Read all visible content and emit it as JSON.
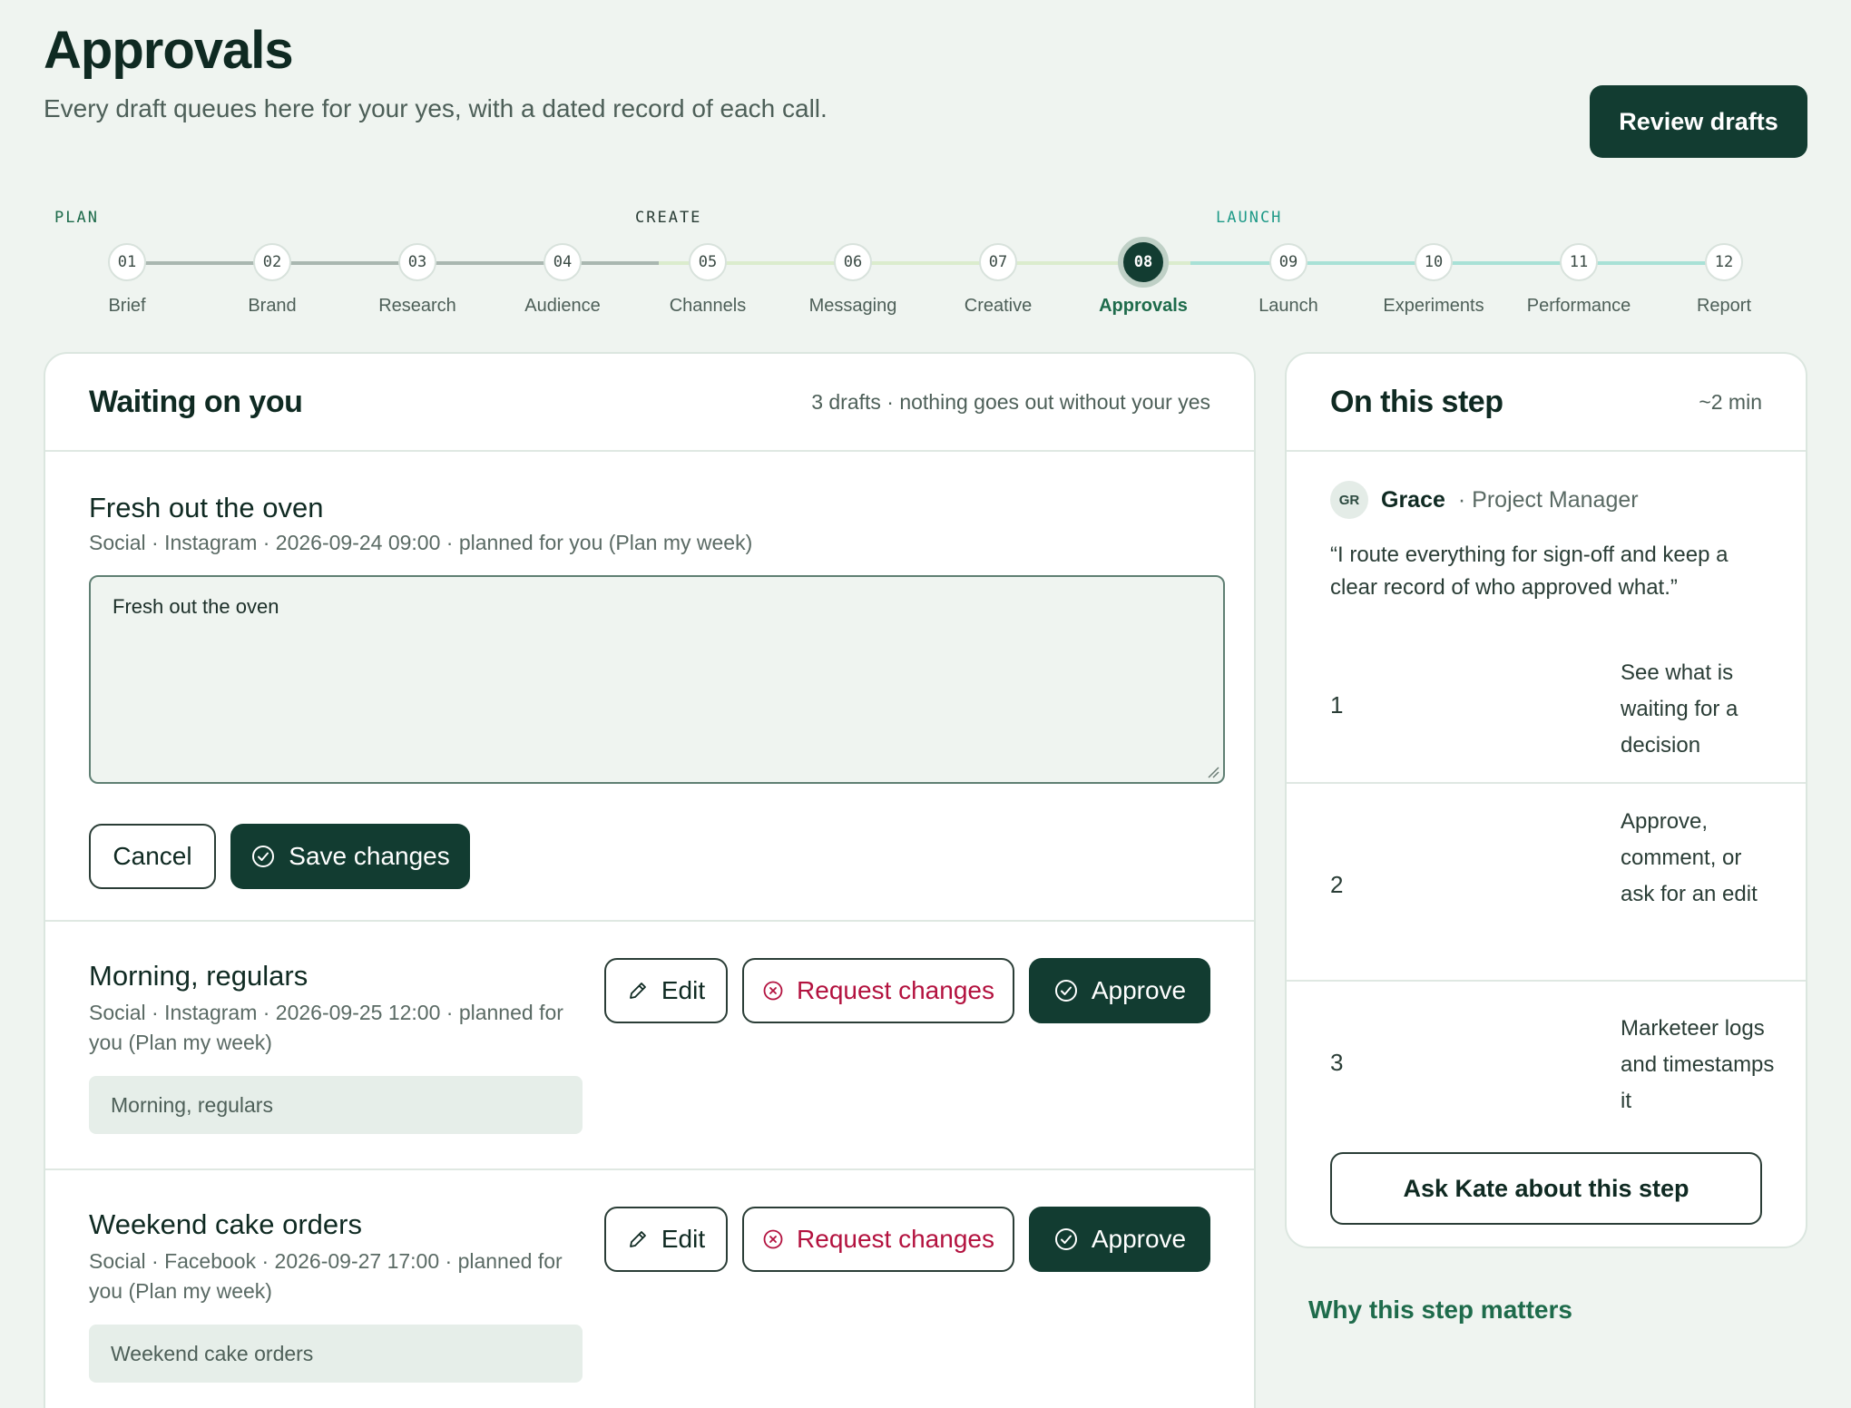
{
  "header": {
    "title": "Approvals",
    "subtitle": "Every draft queues here for your yes, with a dated record of each call.",
    "review_button": "Review drafts"
  },
  "stepper": {
    "phases": [
      {
        "label": "PLAN",
        "color": "#1e6b4b"
      },
      {
        "label": "CREATE",
        "color": "#2a3d36"
      },
      {
        "label": "LAUNCH",
        "color": "#1f9a88"
      }
    ],
    "steps": [
      {
        "num": "01",
        "label": "Brief"
      },
      {
        "num": "02",
        "label": "Brand"
      },
      {
        "num": "03",
        "label": "Research"
      },
      {
        "num": "04",
        "label": "Audience"
      },
      {
        "num": "05",
        "label": "Channels"
      },
      {
        "num": "06",
        "label": "Messaging"
      },
      {
        "num": "07",
        "label": "Creative"
      },
      {
        "num": "08",
        "label": "Approvals"
      },
      {
        "num": "09",
        "label": "Launch"
      },
      {
        "num": "10",
        "label": "Experiments"
      },
      {
        "num": "11",
        "label": "Performance"
      },
      {
        "num": "12",
        "label": "Report"
      }
    ],
    "active_step": "08"
  },
  "queue": {
    "title": "Waiting on you",
    "meta": "3 drafts · nothing goes out without your yes",
    "drafts": [
      {
        "title": "Fresh out the oven",
        "meta": "Social · Instagram · 2026-09-24 09:00 · planned for you (Plan my week)",
        "editor_value": "Fresh out the oven",
        "cancel_label": "Cancel",
        "save_label": "Save changes"
      },
      {
        "title": "Morning, regulars",
        "meta": "Social · Instagram · 2026-09-25 12:00 · planned for you (Plan my week)",
        "preview": "Morning, regulars",
        "edit_label": "Edit",
        "request_label": "Request changes",
        "approve_label": "Approve"
      },
      {
        "title": "Weekend cake orders",
        "meta": "Social · Facebook · 2026-09-27 17:00 · planned for you (Plan my week)",
        "preview": "Weekend cake orders",
        "edit_label": "Edit",
        "request_label": "Request changes",
        "approve_label": "Approve"
      }
    ]
  },
  "side": {
    "title": "On this step",
    "duration": "~2 min",
    "persona": {
      "initials": "GR",
      "name": "Grace",
      "role": "· Project Manager"
    },
    "quote": "“I route everything for sign-off and keep a clear record of who approved what.”",
    "tips": [
      {
        "num": "1",
        "text": "See what is waiting for a decision"
      },
      {
        "num": "2",
        "text": "Approve, comment, or ask for an edit"
      },
      {
        "num": "3",
        "text": "Marketeer logs and timestamps it"
      }
    ],
    "ask_button": "Ask Kate about this step",
    "why_link": "Why this step matters"
  }
}
